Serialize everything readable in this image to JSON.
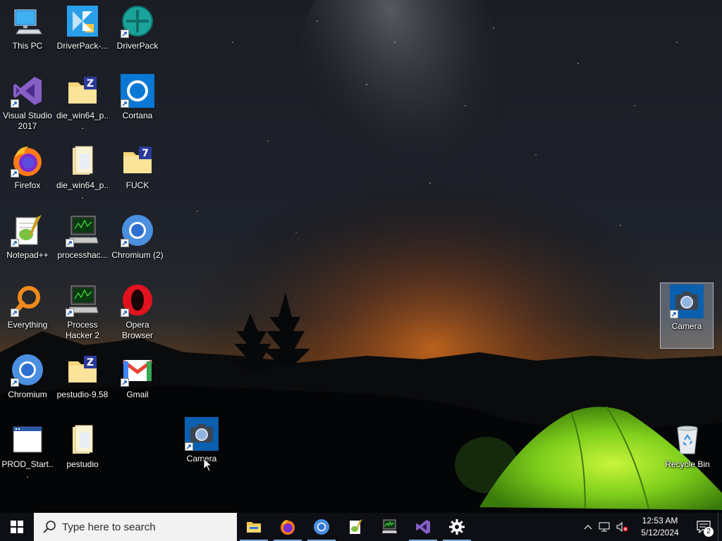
{
  "desktop_icons": [
    {
      "name": "this-pc-icon",
      "label": "This PC",
      "shortcut": false
    },
    {
      "name": "driverpack-installer-icon",
      "label": "DriverPack-...",
      "shortcut": false
    },
    {
      "name": "driverpack-icon",
      "label": "DriverPack",
      "shortcut": true
    },
    {
      "name": "visual-studio-icon",
      "label": "Visual Studio 2017",
      "shortcut": true
    },
    {
      "name": "zip-folder-icon",
      "label": "die_win64_p...",
      "shortcut": false
    },
    {
      "name": "cortana-icon",
      "label": "Cortana",
      "shortcut": true
    },
    {
      "name": "firefox-icon",
      "label": "Firefox",
      "shortcut": true
    },
    {
      "name": "folder-icon",
      "label": "die_win64_p...",
      "shortcut": false
    },
    {
      "name": "7zip-folder-icon",
      "label": "FUCK",
      "shortcut": false
    },
    {
      "name": "notepadpp-icon",
      "label": "Notepad++",
      "shortcut": true
    },
    {
      "name": "processhacker-icon",
      "label": "processhac...",
      "shortcut": true
    },
    {
      "name": "chromium-icon",
      "label": "Chromium (2)",
      "shortcut": true
    },
    {
      "name": "everything-icon",
      "label": "Everything",
      "shortcut": true
    },
    {
      "name": "processhacker2-icon",
      "label": "Process Hacker 2",
      "shortcut": true
    },
    {
      "name": "opera-icon",
      "label": "Opera Browser",
      "shortcut": true
    },
    {
      "name": "chromium-icon",
      "label": "Chromium",
      "shortcut": true
    },
    {
      "name": "zip-folder-icon",
      "label": "pestudio-9.58",
      "shortcut": false
    },
    {
      "name": "gmail-icon",
      "label": "Gmail",
      "shortcut": true
    },
    {
      "name": "prod-start-icon",
      "label": "PROD_Start...",
      "shortcut": false
    },
    {
      "name": "folder-icon",
      "label": "pestudio",
      "shortcut": false
    },
    {
      "name": "camera-icon",
      "label": "Camera",
      "shortcut": true
    },
    {
      "name": "camera-icon",
      "label": "Camera",
      "shortcut": true
    },
    {
      "name": "recycle-bin-icon",
      "label": "Recycle Bin",
      "shortcut": false
    }
  ],
  "taskbar": {
    "search_placeholder": "Type here to search",
    "apps": [
      {
        "name": "file-explorer-icon",
        "label": "File Explorer",
        "running": true
      },
      {
        "name": "firefox-icon",
        "label": "Firefox",
        "running": true
      },
      {
        "name": "chromium-icon",
        "label": "Chromium",
        "running": true
      },
      {
        "name": "notepadpp-icon",
        "label": "Notepad++",
        "running": false
      },
      {
        "name": "processhacker-icon",
        "label": "Process Hacker",
        "running": false
      },
      {
        "name": "visual-studio-icon",
        "label": "Visual Studio",
        "running": true
      },
      {
        "name": "settings-gear-icon",
        "label": "Settings",
        "running": true
      }
    ],
    "clock_time": "12:53 AM",
    "clock_date": "5/12/2024",
    "notification_count": "2"
  }
}
